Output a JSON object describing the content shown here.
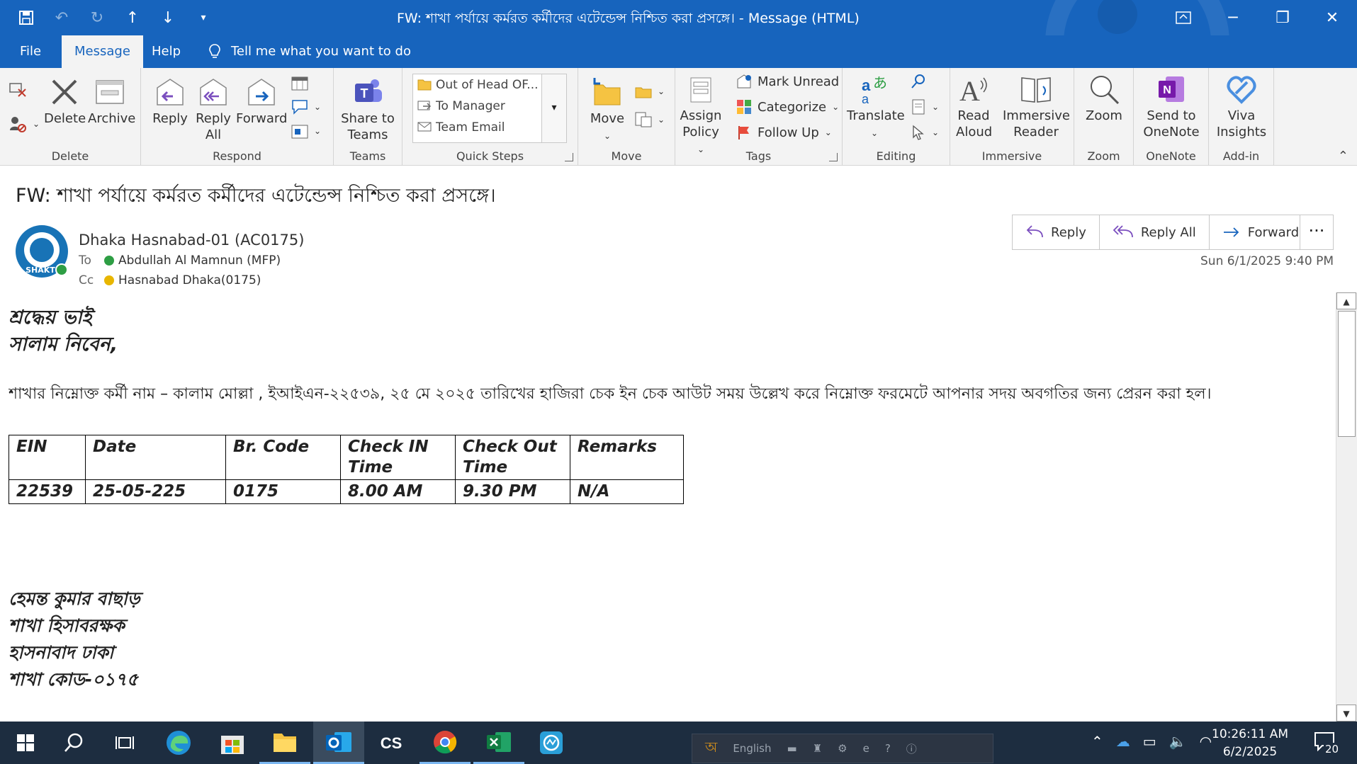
{
  "window": {
    "title": "FW: শাখা পর্যায়ে কর্মরত কর্মীদের এটেন্ডেন্স নিশ্চিত করা প্রসঙ্গে।  -  Message (HTML)"
  },
  "menu": {
    "file": "File",
    "message": "Message",
    "help": "Help",
    "tell_me": "Tell me what you want to do"
  },
  "ribbon": {
    "delete_group": {
      "label": "Delete",
      "delete": "Delete",
      "archive": "Archive"
    },
    "respond_group": {
      "label": "Respond",
      "reply": "Reply",
      "reply_all_1": "Reply",
      "reply_all_2": "All",
      "forward": "Forward"
    },
    "teams_group": {
      "label": "Teams",
      "share_1": "Share to",
      "share_2": "Teams"
    },
    "quick_steps": {
      "label": "Quick Steps",
      "items": [
        "Out of Head OF...",
        "To Manager",
        "Team Email"
      ]
    },
    "move_group": {
      "label": "Move",
      "move": "Move"
    },
    "tags_group": {
      "label": "Tags",
      "assign_1": "Assign",
      "assign_2": "Policy",
      "mark_unread": "Mark Unread",
      "categorize": "Categorize",
      "follow_up": "Follow Up"
    },
    "editing_group": {
      "label": "Editing",
      "translate": "Translate"
    },
    "immersive_group": {
      "label": "Immersive",
      "read_1": "Read",
      "read_2": "Aloud",
      "reader_1": "Immersive",
      "reader_2": "Reader"
    },
    "zoom_group": {
      "label": "Zoom",
      "zoom": "Zoom"
    },
    "onenote_group": {
      "label": "OneNote",
      "send_1": "Send to",
      "send_2": "OneNote"
    },
    "addin_group": {
      "label": "Add-in",
      "viva_1": "Viva",
      "viva_2": "Insights"
    }
  },
  "message": {
    "subject": "FW: শাখা পর্যায়ে কর্মরত কর্মীদের এটেন্ডেন্স নিশ্চিত করা প্রসঙ্গে।",
    "sender": "Dhaka Hasnabad-01 (AC0175)",
    "avatar_text": "SHAKTI",
    "to_label": "To",
    "to": "Abdullah Al Mamnun (MFP)",
    "cc_label": "Cc",
    "cc": "Hasnabad Dhaka(0175)",
    "datetime": "Sun 6/1/2025 9:40 PM",
    "actions": {
      "reply": "Reply",
      "reply_all": "Reply All",
      "forward": "Forward",
      "more": "···"
    },
    "body": {
      "greeting_1": "শ্রদ্ধেয় ভাই",
      "greeting_2": "সালাম নিবেন,",
      "paragraph": "শাখার নিম্নোক্ত কর্মী নাম – কালাম মোল্লা , ইআইএন-২২৫৩৯,  ২৫ মে ২০২৫ তারিখের হাজিরা চেক ইন চেক আউট সময় উল্লেখ করে নিম্নোক্ত ফরমেটে আপনার সদয় অবগতির জন্য প্রেরন করা হল।",
      "table": {
        "headers": [
          "EIN",
          "Date",
          "Br. Code",
          "Check IN Time",
          "Check Out Time",
          "Remarks"
        ],
        "rows": [
          [
            "22539",
            "25-05-225",
            "0175",
            "8.00 AM",
            "9.30 PM",
            "N/A"
          ]
        ]
      },
      "signature": [
        "হেমন্ত কুমার বাছাড়",
        "শাখা হিসাবরক্ষক",
        "হাসনাবাদ ঢাকা",
        "শাখা কোড-০১৭৫"
      ]
    }
  },
  "taskbar": {
    "language": "English",
    "time": "10:26:11 AM",
    "date": "6/2/2025",
    "notifications": "20"
  },
  "colors": {
    "accent": "#1764bd",
    "ribbon_bg": "#f3f3f3",
    "taskbar": "#1d2d40",
    "presence_available": "#2e9e44",
    "presence_away": "#e8b600"
  }
}
